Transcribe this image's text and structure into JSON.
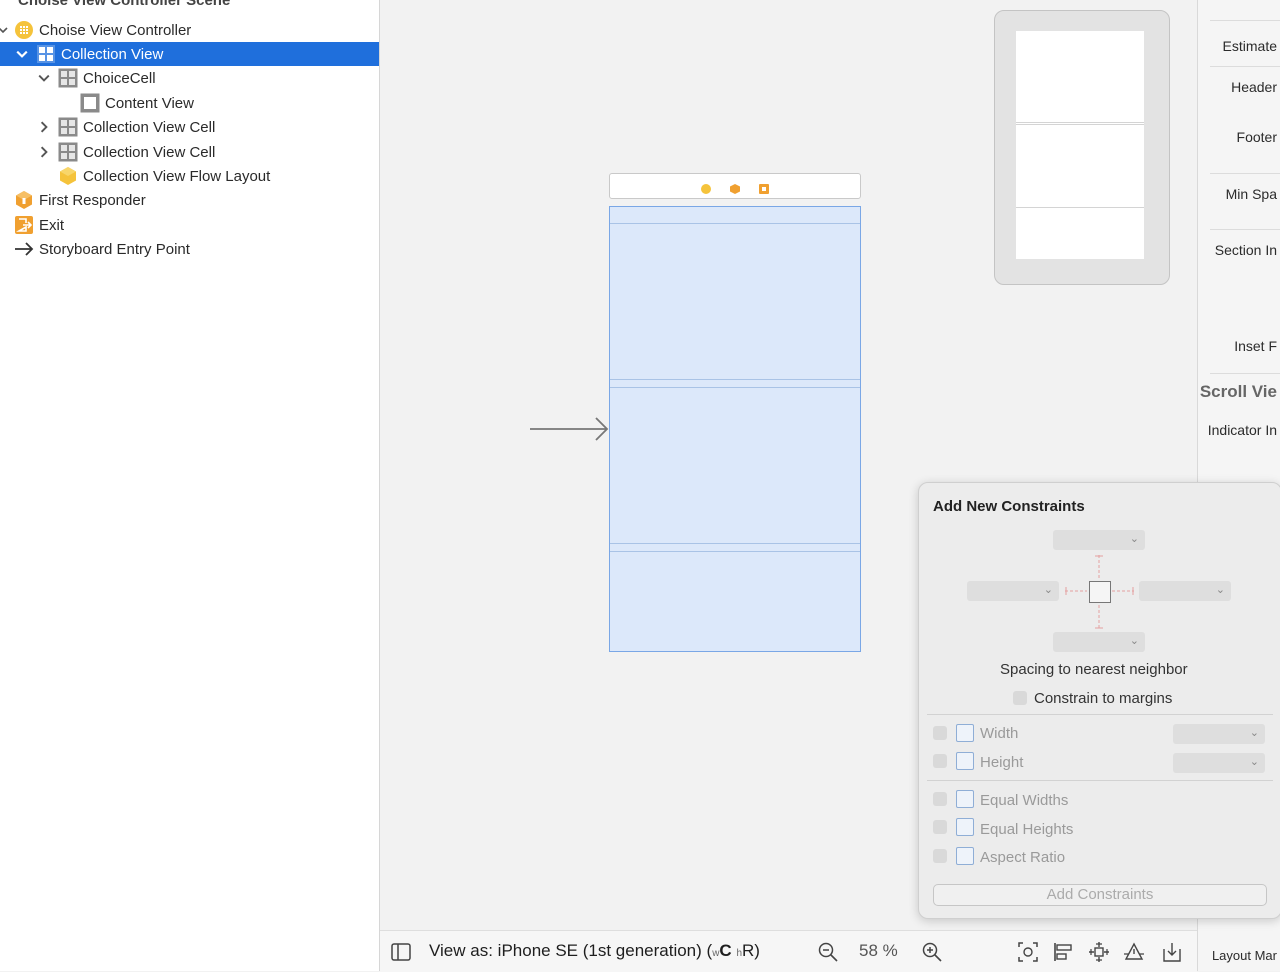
{
  "outline": {
    "scene_title": "Choise View Controller Scene",
    "items": [
      {
        "label": "Choise View Controller"
      },
      {
        "label": "Collection View"
      },
      {
        "label": "ChoiceCell"
      },
      {
        "label": "Content View"
      },
      {
        "label": "Collection View Cell"
      },
      {
        "label": "Collection View Cell"
      },
      {
        "label": "Collection View Flow Layout"
      },
      {
        "label": "First Responder"
      },
      {
        "label": "Exit"
      },
      {
        "label": "Storyboard Entry Point"
      }
    ]
  },
  "bottom_bar": {
    "view_as": "View as: iPhone SE (1st generation) (",
    "size_w": "w",
    "size_c": "C",
    "size_h": "h",
    "size_r": "R)",
    "zoom": "58 %"
  },
  "inspector": {
    "labels": [
      "Estimate",
      "Header",
      "Footer",
      "Min Spa",
      "Section In",
      "Inset F"
    ],
    "section_title": "Scroll Vie",
    "indicator": "Indicator In",
    "layout_margins": "Layout Mar"
  },
  "constraints": {
    "title": "Add New Constraints",
    "spacing_label": "Spacing to nearest neighbor",
    "margins_label": "Constrain to margins",
    "width_label": "Width",
    "height_label": "Height",
    "equal_widths": "Equal Widths",
    "equal_heights": "Equal Heights",
    "aspect_ratio": "Aspect Ratio",
    "add_button": "Add Constraints"
  },
  "colors": {
    "selection": "#1f6fdc",
    "canvas_view": "#dce8fa",
    "accent_orange": "#f0a030",
    "accent_yellow": "#f5c33b"
  }
}
